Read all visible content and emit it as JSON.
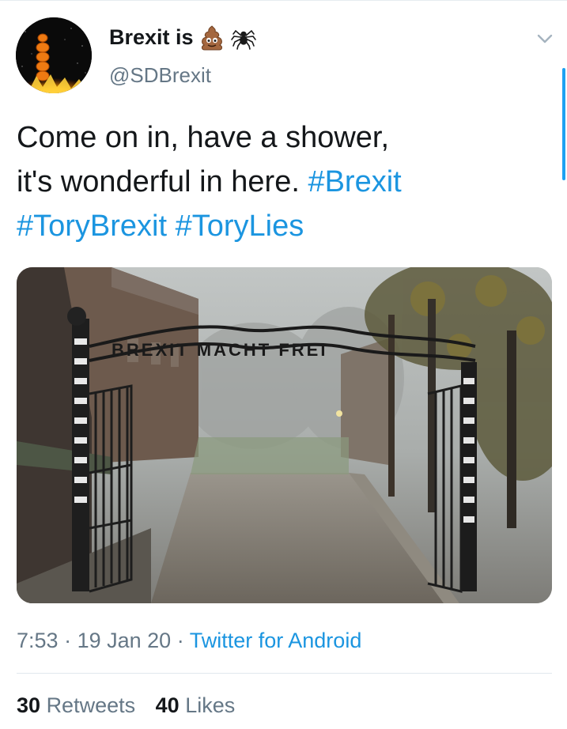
{
  "author": {
    "name": "Brexit is",
    "handle": "@SDBrexit",
    "name_emojis": [
      "pile-of-poo-emoji",
      "spider-emoji"
    ]
  },
  "tweet": {
    "text_lines": [
      [
        {
          "t": "Come on in, have a shower,",
          "tag": false
        }
      ],
      [
        {
          "t": "it's wonderful in here. ",
          "tag": false
        },
        {
          "t": "#Brexit",
          "tag": true
        }
      ],
      [
        {
          "t": "#ToryBrexit",
          "tag": true
        },
        {
          "t": " ",
          "tag": false
        },
        {
          "t": "#ToryLies",
          "tag": true
        }
      ]
    ],
    "image": {
      "sign_text": "BREXIT MACHT FREI"
    }
  },
  "meta": {
    "time": "7:53",
    "separator": "·",
    "date": "19 Jan 20",
    "source": "Twitter for Android"
  },
  "stats": {
    "retweets_count": "30",
    "retweets_label": "Retweets",
    "likes_count": "40",
    "likes_label": "Likes"
  },
  "colors": {
    "link": "#1b95e0",
    "secondary_text": "#657786",
    "primary_text": "#14171a",
    "accent": "#1da1f2"
  }
}
